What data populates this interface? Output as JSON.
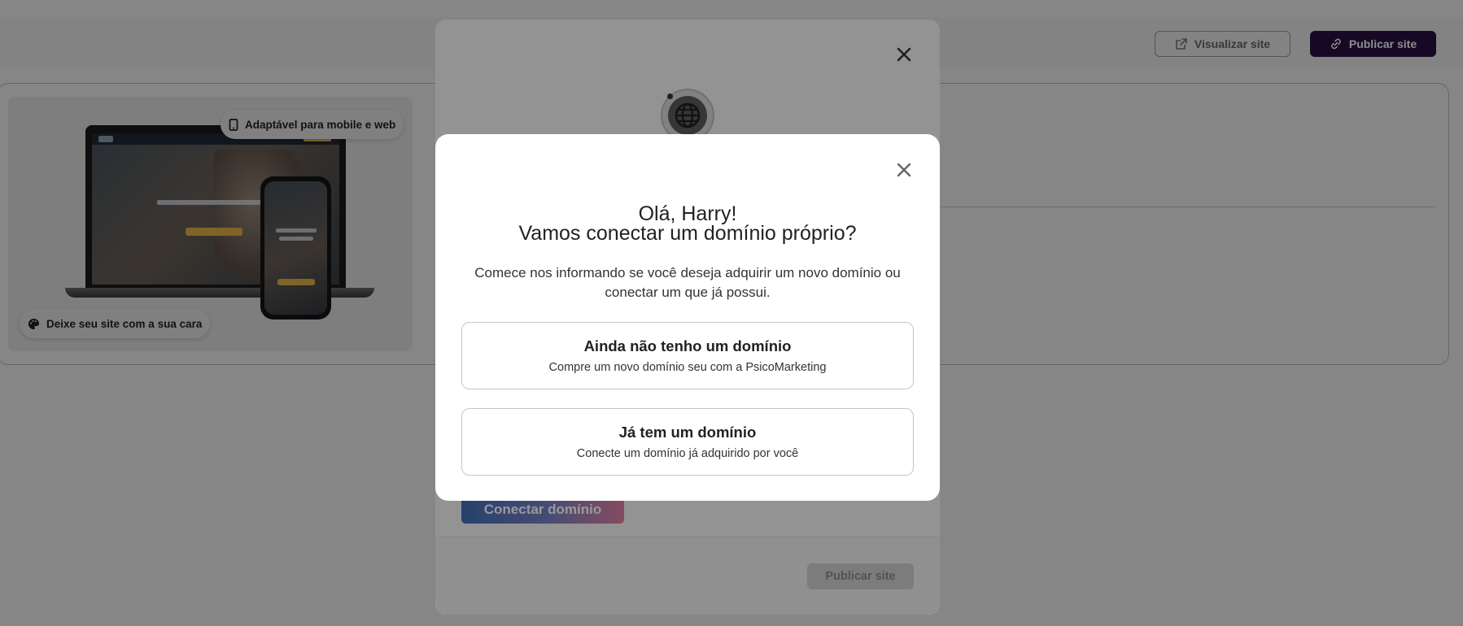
{
  "background": {
    "header": {
      "preview_button": "Visualizar site",
      "publish_button": "Publicar site"
    },
    "site_preview": {
      "pill_top": "Adaptável para mobile e web",
      "pill_bottom": "Deixe seu site com a sua cara"
    }
  },
  "back_dialog": {
    "connect_button": "Conectar domínio",
    "publish_button": "Publicar site"
  },
  "modal": {
    "title_line1": "Olá, Harry!",
    "title_line2": "Vamos conectar um domínio próprio?",
    "description": "Comece nos informando se você deseja adquirir um novo domínio ou conectar um que já possui.",
    "options": [
      {
        "title": "Ainda não tenho um domínio",
        "subtitle": "Compre um novo domínio seu com a PsicoMarketing"
      },
      {
        "title": "Já tem um domínio",
        "subtitle": "Conecte um domínio já adquirido por você"
      }
    ]
  },
  "colors": {
    "brand_dark": "#2a0f45",
    "overlay": "rgba(0,0,0,0.45)",
    "cta_gradient_start": "#3f6fb5",
    "cta_gradient_end": "#e07ea0"
  },
  "icons": [
    "external-link-icon",
    "link-icon",
    "phone-icon",
    "palette-icon",
    "globe-icon",
    "close-icon"
  ]
}
